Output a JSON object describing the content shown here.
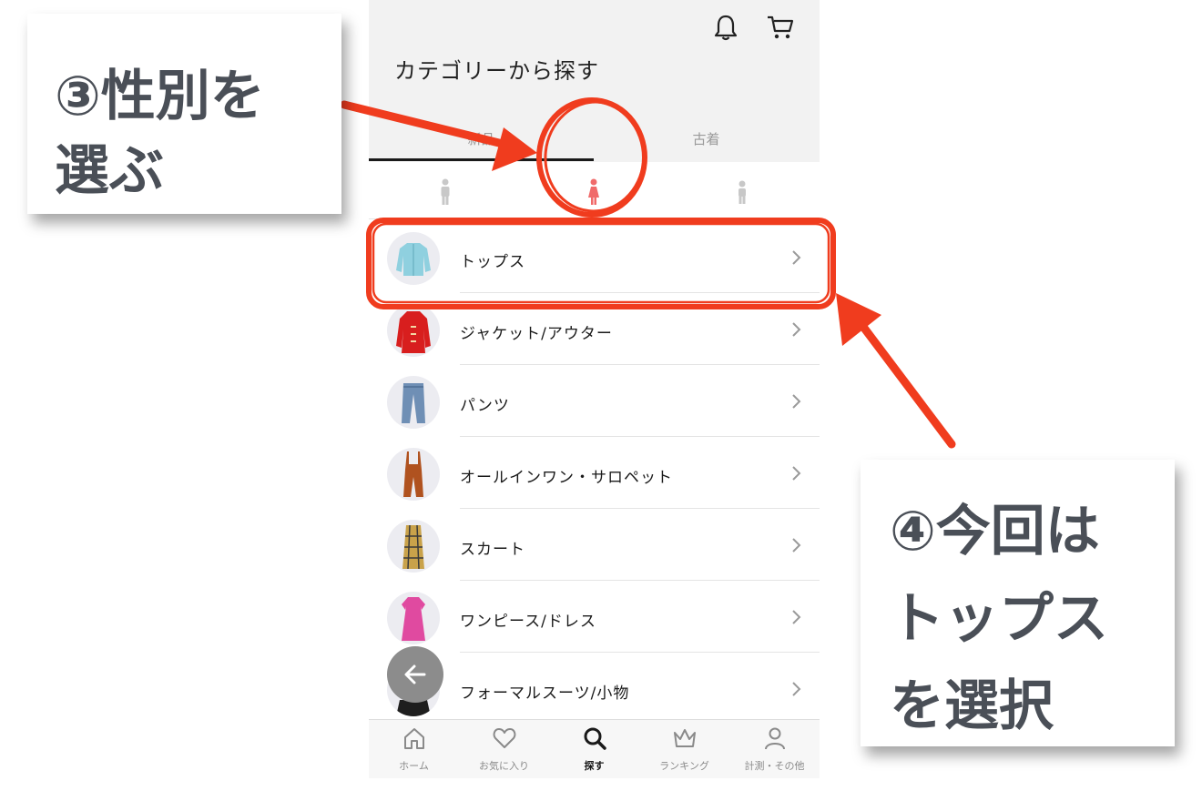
{
  "header": {
    "title": "カテゴリーから探す"
  },
  "tabs": [
    {
      "label": "新品",
      "active": true
    },
    {
      "label": "古着",
      "active": false
    }
  ],
  "gender_filter": {
    "options": [
      "men",
      "women",
      "kids"
    ],
    "selected": "women",
    "selected_color": "#f06a6a"
  },
  "categories": [
    {
      "label": "トップス",
      "icon": "cardigan-icon"
    },
    {
      "label": "ジャケット/アウター",
      "icon": "coat-icon"
    },
    {
      "label": "パンツ",
      "icon": "jeans-icon"
    },
    {
      "label": "オールインワン・サロペット",
      "icon": "overalls-icon"
    },
    {
      "label": "スカート",
      "icon": "skirt-icon"
    },
    {
      "label": "ワンピース/ドレス",
      "icon": "dress-icon"
    },
    {
      "label": "フォーマルスーツ/小物",
      "icon": "formal-icon"
    }
  ],
  "bottom_nav": [
    {
      "label": "ホーム",
      "icon": "home-icon",
      "active": false
    },
    {
      "label": "お気に入り",
      "icon": "heart-icon",
      "active": false
    },
    {
      "label": "探す",
      "icon": "search-icon",
      "active": true
    },
    {
      "label": "ランキング",
      "icon": "crown-icon",
      "active": false
    },
    {
      "label": "計測・その他",
      "icon": "user-icon",
      "active": false
    }
  ],
  "annotations": {
    "callout_1": {
      "line1": "③性別を",
      "line2": "選ぶ"
    },
    "callout_2": {
      "line1": "④今回は",
      "line2": "トップス",
      "line3": "を選択"
    },
    "marker_color": "#f03c1e"
  }
}
